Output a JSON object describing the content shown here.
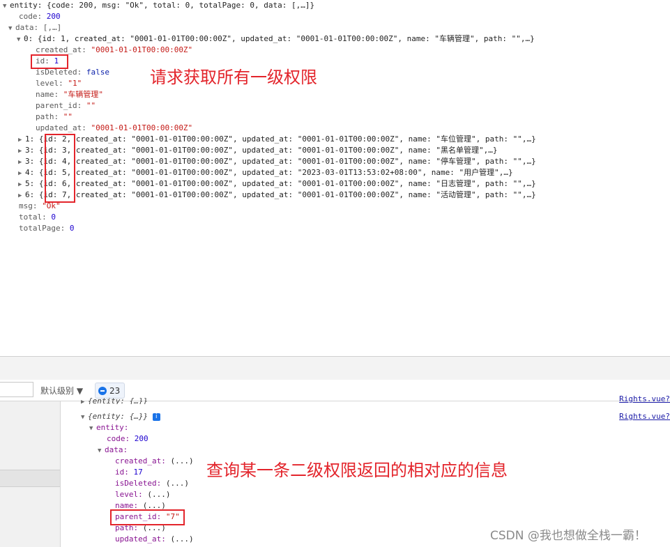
{
  "top_log": {
    "entity_line": "entity: {code: 200, msg: \"Ok\", total: 0, totalPage: 0, data: [,…]}",
    "code_key": "code",
    "code_val": "200",
    "data_line": "data: [,…]",
    "item0_summary": "0: {id: 1, created_at: \"0001-01-01T00:00:00Z\", updated_at: \"0001-01-01T00:00:00Z\", name: \"车辆管理\", path: \"\",…}",
    "item0_fields": [
      {
        "key": "created_at",
        "value": "\"0001-01-01T00:00:00Z\""
      },
      {
        "key": "id",
        "value": "1"
      },
      {
        "key": "isDeleted",
        "value": "false"
      },
      {
        "key": "level",
        "value": "\"1\""
      },
      {
        "key": "name",
        "value": "\"车辆管理\""
      },
      {
        "key": "parent_id",
        "value": "\"\""
      },
      {
        "key": "path",
        "value": "\"\""
      },
      {
        "key": "updated_at",
        "value": "\"0001-01-01T00:00:00Z\""
      }
    ],
    "items": [
      "1: {id: 2, created_at: \"0001-01-01T00:00:00Z\", updated_at: \"0001-01-01T00:00:00Z\", name: \"车位管理\", path: \"\",…}",
      "3: {id: 3, created_at: \"0001-01-01T00:00:00Z\", updated_at: \"0001-01-01T00:00:00Z\", name: \"黑名单管理\",…}",
      "3: {id: 4, created_at: \"0001-01-01T00:00:00Z\", updated_at: \"0001-01-01T00:00:00Z\", name: \"停车管理\", path: \"\",…}",
      "4: {id: 5, created_at: \"0001-01-01T00:00:00Z\", updated_at: \"2023-03-01T13:53:02+08:00\", name: \"用户管理\",…}",
      "5: {id: 6, created_at: \"0001-01-01T00:00:00Z\", updated_at: \"0001-01-01T00:00:00Z\", name: \"日志管理\", path: \"\",…}",
      "6: {id: 7, created_at: \"0001-01-01T00:00:00Z\", updated_at: \"0001-01-01T00:00:00Z\", name: \"活动管理\", path: \"\",…}"
    ],
    "msg": {
      "key": "msg",
      "value": "\"Ok\""
    },
    "total": {
      "key": "total",
      "value": "0"
    },
    "totalPage": {
      "key": "totalPage",
      "value": "0"
    }
  },
  "annotations": {
    "first": "请求获取所有一级权限",
    "second": "查询某一条二级权限返回的相对应的信息"
  },
  "filter_bar": {
    "level_label": "默认级别 ▼",
    "issues_count": "23"
  },
  "console": {
    "collapsed_entry": "{entity: {…}}",
    "expanded_entry": "{entity: {…}}",
    "link1": "Rights.vue?",
    "link2": "Rights.vue?",
    "entity_key": "entity:",
    "code_key": "code:",
    "code_val": "200",
    "data_key": "data:",
    "fields": [
      {
        "key": "created_at:",
        "value": "(...)"
      },
      {
        "key": "id:",
        "value": "17"
      },
      {
        "key": "isDeleted:",
        "value": "(...)"
      },
      {
        "key": "level:",
        "value": "(...)"
      },
      {
        "key": "name:",
        "value": "(...)"
      },
      {
        "key": "parent_id:",
        "value": "\"7\""
      },
      {
        "key": "path:",
        "value": "(...)"
      },
      {
        "key": "updated_at:",
        "value": "(...)"
      }
    ]
  },
  "watermark": "CSDN @我也想做全栈一霸！",
  "colors": {
    "annotation_red": "#e3242b",
    "link_blue": "#1a1aa6"
  }
}
